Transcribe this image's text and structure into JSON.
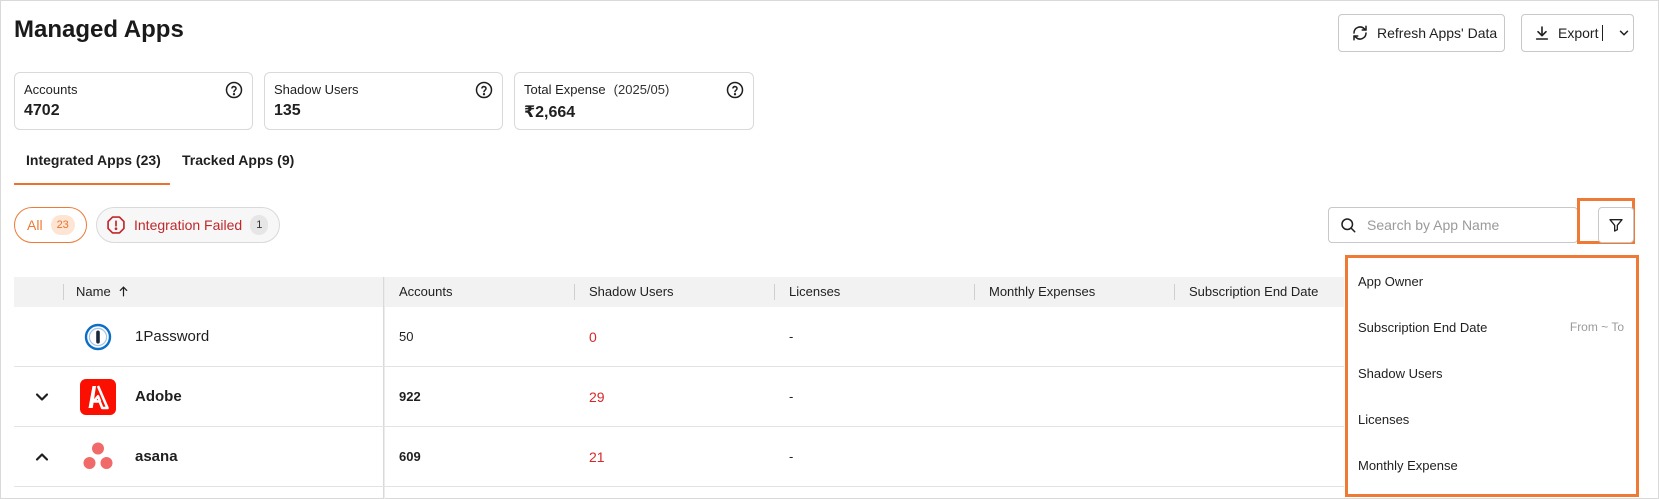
{
  "page": {
    "title": "Managed Apps"
  },
  "toolbar": {
    "refresh_label": "Refresh Apps' Data",
    "export_label": "Export"
  },
  "stats": [
    {
      "label": "Accounts",
      "sublabel": "",
      "value": "4702"
    },
    {
      "label": "Shadow Users",
      "sublabel": "",
      "value": "135"
    },
    {
      "label": "Total Expense",
      "sublabel": "(2025/05)",
      "value": "₹2,664"
    }
  ],
  "tabs": [
    {
      "label": "Integrated Apps (23)",
      "active": true
    },
    {
      "label": "Tracked Apps (9)",
      "active": false
    }
  ],
  "filters": {
    "all": {
      "label": "All",
      "count": "23",
      "selected": true
    },
    "failed": {
      "label": "Integration Failed",
      "count": "1"
    }
  },
  "search": {
    "placeholder": "Search by App Name",
    "value": ""
  },
  "table": {
    "columns": [
      "Name",
      "Accounts",
      "Shadow Users",
      "Licenses",
      "Monthly Expenses",
      "Subscription End Date"
    ],
    "sort": {
      "column": "Name",
      "direction": "asc"
    },
    "rows": [
      {
        "name": "1Password",
        "accounts": "50",
        "shadow_users": "0",
        "licenses": "-",
        "expandable": false,
        "expanded": false,
        "icon": "1password-logo"
      },
      {
        "name": "Adobe",
        "accounts": "922",
        "shadow_users": "29",
        "licenses": "-",
        "expandable": true,
        "expanded": false,
        "icon": "adobe-logo"
      },
      {
        "name": "asana",
        "accounts": "609",
        "shadow_users": "21",
        "licenses": "-",
        "expandable": true,
        "expanded": true,
        "icon": "asana-logo"
      }
    ]
  },
  "filter_menu": {
    "items": [
      "App Owner",
      "Subscription End Date",
      "Shadow Users",
      "Licenses",
      "Monthly Expense"
    ],
    "date_range_placeholder": "From ~ To"
  },
  "colors": {
    "accent": "#ee7a36",
    "danger": "#d62828",
    "header_bg": "#f2f2f2"
  }
}
